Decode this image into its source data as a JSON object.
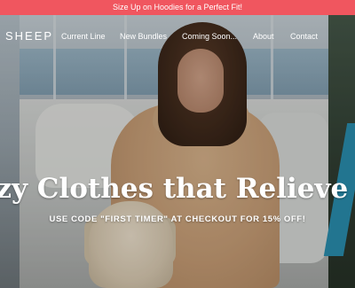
{
  "announcement": {
    "text": "Size Up on Hoodies for a Perfect Fit!"
  },
  "header": {
    "brand": "SHEEP",
    "nav": [
      {
        "label": "Current Line"
      },
      {
        "label": "New Bundles"
      },
      {
        "label": "Coming Soon..."
      },
      {
        "label": "About"
      },
      {
        "label": "Contact"
      }
    ]
  },
  "hero": {
    "headline": "Cozy Clothes that Relieve Anxiety",
    "subline": "USE CODE \"FIRST TIMER\" AT CHECKOUT FOR 15% OFF!"
  },
  "colors": {
    "announcement_bg": "#f0565f",
    "text": "#ffffff"
  }
}
